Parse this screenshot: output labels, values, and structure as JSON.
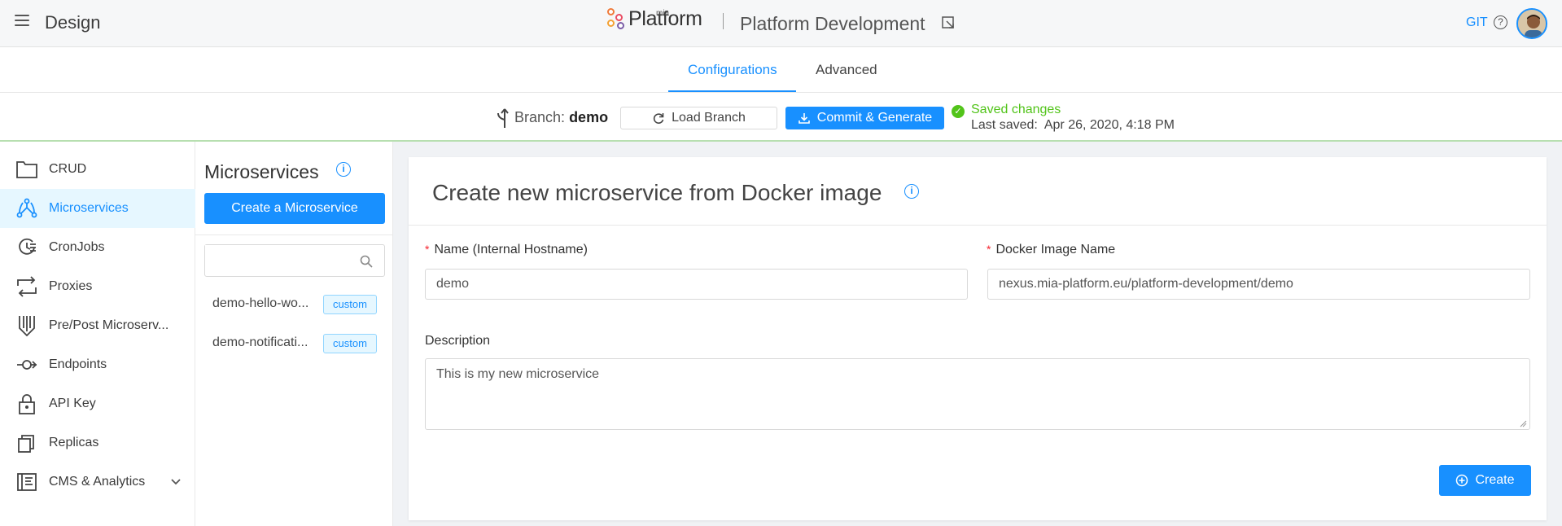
{
  "header": {
    "app_title": "Design",
    "logo_small": "mia",
    "logo_text": "Platform",
    "project_title": "Platform Development",
    "git_label": "GIT",
    "help_symbol": "?"
  },
  "tabs": [
    {
      "label": "Configurations",
      "active": true
    },
    {
      "label": "Advanced",
      "active": false
    }
  ],
  "branch_bar": {
    "branch_prefix": "Branch:",
    "branch_name": "demo",
    "load_branch_label": "Load Branch",
    "commit_label": "Commit & Generate",
    "saved_status": "Saved changes",
    "last_saved_label": "Last saved:",
    "last_saved_value": "Apr 26, 2020, 4:18 PM"
  },
  "sidebar": {
    "items": [
      {
        "label": "CRUD",
        "icon": "folder-icon",
        "active": false
      },
      {
        "label": "Microservices",
        "icon": "microservices-icon",
        "active": true
      },
      {
        "label": "CronJobs",
        "icon": "cronjob-icon",
        "active": false
      },
      {
        "label": "Proxies",
        "icon": "proxy-icon",
        "active": false
      },
      {
        "label": "Pre/Post Microserv...",
        "icon": "decorator-icon",
        "active": false
      },
      {
        "label": "Endpoints",
        "icon": "endpoint-icon",
        "active": false
      },
      {
        "label": "API Key",
        "icon": "lock-icon",
        "active": false
      },
      {
        "label": "Replicas",
        "icon": "replicas-icon",
        "active": false
      },
      {
        "label": "CMS & Analytics",
        "icon": "cms-icon",
        "active": false
      }
    ]
  },
  "microservices_panel": {
    "title": "Microservices",
    "create_label": "Create a Microservice",
    "search_value": "",
    "items": [
      {
        "name": "demo-hello-wo...",
        "tag": "custom"
      },
      {
        "name": "demo-notificati...",
        "tag": "custom"
      }
    ]
  },
  "form": {
    "title": "Create new microservice from Docker image",
    "name_label": "Name (Internal Hostname)",
    "name_value": "demo",
    "image_label": "Docker Image Name",
    "image_value": "nexus.mia-platform.eu/platform-development/demo",
    "description_label": "Description",
    "description_value": "This is my new microservice",
    "create_label": "Create"
  },
  "colors": {
    "primary": "#1890ff",
    "success": "#52c41a",
    "required": "#f5222d"
  }
}
